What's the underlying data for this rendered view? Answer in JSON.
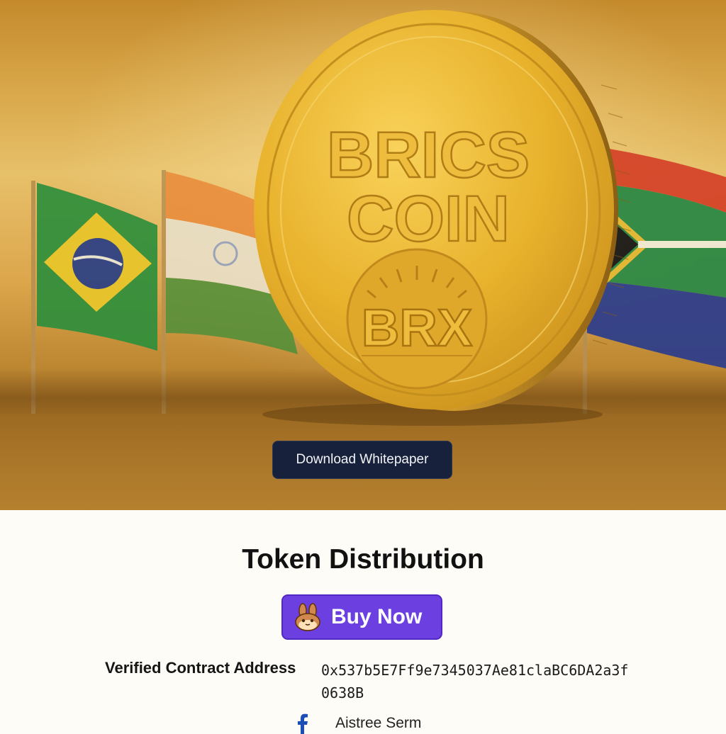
{
  "hero": {
    "coin_line1": "BRICS",
    "coin_line2": "COIN",
    "coin_ticker": "BRX",
    "cta_label": "Download Whitepaper"
  },
  "section": {
    "title": "Token Distribution"
  },
  "buy": {
    "label": "Buy Now",
    "icon": "pancakeswap-bunny-icon"
  },
  "contract": {
    "label": "Verified Contract Address",
    "value": "0x537b5E7Ff9e7345037Ae81claBC6DA2a3f0638B"
  },
  "social": {
    "icon": "facebook-icon",
    "label": "Aistree Serm"
  },
  "colors": {
    "cta_bg": "#17213b",
    "buy_bg": "#6b3fe0",
    "coin_gold": "#e6b12e",
    "page_bg": "#fdfcf6"
  }
}
